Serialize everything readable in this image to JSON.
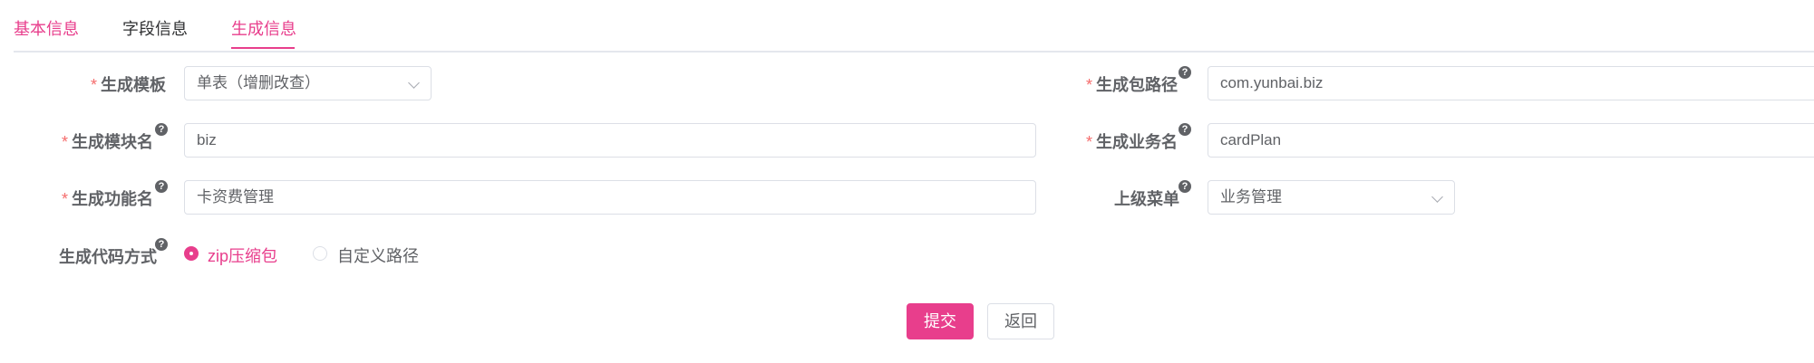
{
  "tabs": [
    {
      "label": "基本信息",
      "active": false
    },
    {
      "label": "字段信息",
      "active": false
    },
    {
      "label": "生成信息",
      "active": true
    }
  ],
  "required_mark": "*",
  "help_glyph": "?",
  "form": {
    "template": {
      "label": "生成模板",
      "value": "单表（增删改查）"
    },
    "package_path": {
      "label": "生成包路径",
      "value": "com.yunbai.biz"
    },
    "module_name": {
      "label": "生成模块名",
      "value": "biz"
    },
    "business_name": {
      "label": "生成业务名",
      "value": "cardPlan"
    },
    "function_name": {
      "label": "生成功能名",
      "value": "卡资费管理"
    },
    "parent_menu": {
      "label": "上级菜单",
      "value": "业务管理"
    },
    "gen_type": {
      "label": "生成代码方式",
      "options": [
        {
          "label": "zip压缩包",
          "selected": true
        },
        {
          "label": "自定义路径",
          "selected": false
        }
      ]
    }
  },
  "buttons": {
    "submit": "提交",
    "back": "返回"
  },
  "colors": {
    "accent": "#e83e8c",
    "required": "#f56c6c",
    "border": "#dcdfe6",
    "text": "#606266"
  }
}
